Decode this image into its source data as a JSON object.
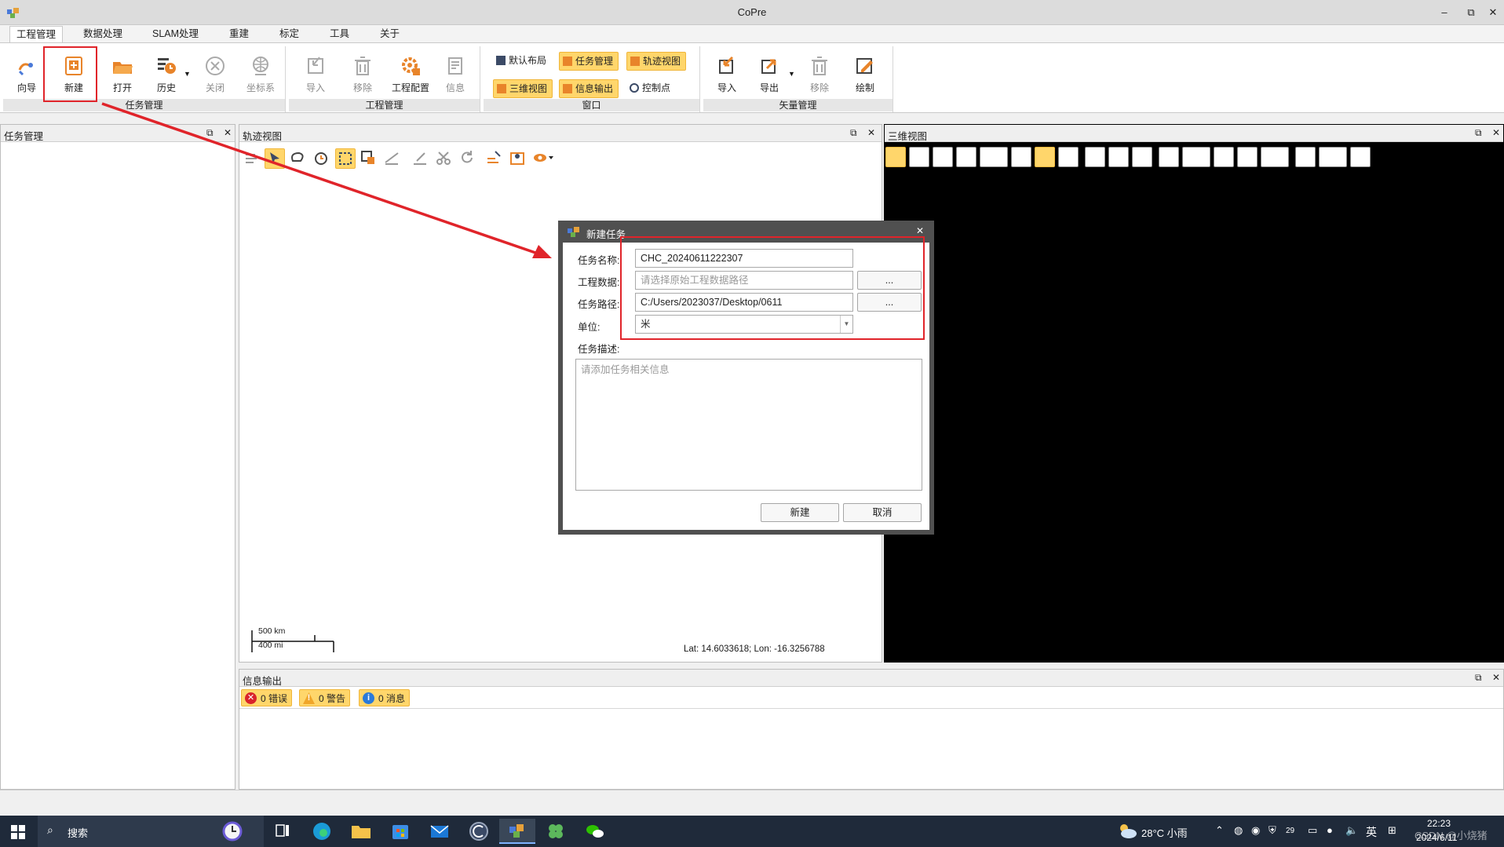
{
  "window": {
    "title": "CoPre",
    "minimize": "–",
    "restore": "⧉",
    "close": "✕"
  },
  "menu": [
    "工程管理",
    "数据处理",
    "SLAM处理",
    "重建",
    "标定",
    "工具",
    "关于"
  ],
  "ribbon": {
    "task_group": {
      "label": "任务管理",
      "buttons": [
        "向导",
        "新建",
        "打开",
        "历史",
        "关闭",
        "坐标系"
      ]
    },
    "project_group": {
      "label": "工程管理",
      "buttons": [
        "导入",
        "移除",
        "工程配置",
        "信息"
      ]
    },
    "window_group": {
      "label": "窗口",
      "buttons": [
        "默认布局",
        "任务管理",
        "轨迹视图",
        "三维视图",
        "信息输出",
        "控制点"
      ]
    },
    "vector_group": {
      "label": "矢量管理",
      "buttons": [
        "导入",
        "导出",
        "移除",
        "绘制"
      ]
    }
  },
  "panels": {
    "task": {
      "title": "任务管理"
    },
    "track": {
      "title": "轨迹视图",
      "scale_km": "500 km",
      "scale_mi": "400 mi",
      "coords": "Lat: 14.6033618; Lon: -16.3256788"
    },
    "view3d": {
      "title": "三维视图"
    },
    "info": {
      "title": "信息输出",
      "errors": "0 错误",
      "warnings": "0 警告",
      "messages": "0 消息"
    }
  },
  "dialog": {
    "title": "新建任务",
    "close": "✕",
    "name_label": "任务名称:",
    "name_value": "CHC_20240611222307",
    "data_label": "工程数据:",
    "data_placeholder": "请选择原始工程数据路径",
    "path_label": "任务路径:",
    "path_value": "C:/Users/2023037/Desktop/0611",
    "browse": "...",
    "unit_label": "单位:",
    "unit_value": "米",
    "desc_label": "任务描述:",
    "desc_placeholder": "请添加任务相关信息",
    "ok": "新建",
    "cancel": "取消"
  },
  "taskbar": {
    "search": "搜索",
    "weather": "28°C  小雨",
    "ime": "英",
    "time": "22:23",
    "date": "2024/6/11",
    "badge": "29",
    "watermark": "CSDN @小烧猪"
  },
  "colors": {
    "accent": "#ffd66b",
    "annotation": "#e0242a",
    "view3d_bg": "#000000"
  }
}
